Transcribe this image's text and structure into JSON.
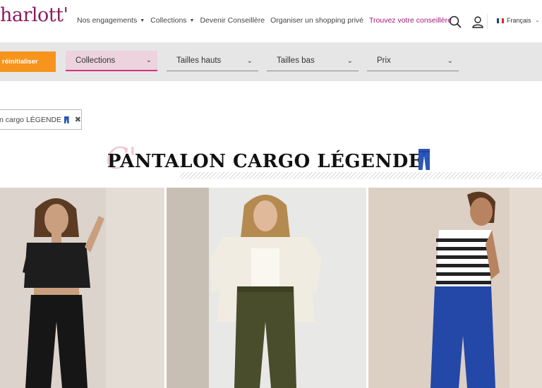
{
  "header": {
    "logo": "harlott'",
    "nav": [
      {
        "label": "Nos engagements",
        "caret": true
      },
      {
        "label": "Collections",
        "caret": true
      },
      {
        "label": "Devenir Conseillère",
        "caret": false
      },
      {
        "label": "Organiser un shopping privé",
        "caret": false
      },
      {
        "label": "Trouvez votre conseillère",
        "caret": false,
        "highlight": true
      }
    ],
    "language": "Français",
    "icons": {
      "search": "search-icon",
      "account": "user-icon",
      "flag": "flag-fr-icon"
    }
  },
  "filters": {
    "reset_label": "réinitialiser",
    "selects": [
      {
        "label": "Collections",
        "active": true
      },
      {
        "label": "Tailles hauts",
        "active": false
      },
      {
        "label": "Tailles bas",
        "active": false
      },
      {
        "label": "Prix",
        "active": false
      }
    ]
  },
  "active_tag": {
    "label": "n cargo LÉGENDE",
    "icon": "jeans-icon",
    "remove_icon": "close-icon"
  },
  "section": {
    "title": "PANTALON CARGO LÉGENDE",
    "decor_letter": "C'",
    "title_icon": "jeans-icon"
  },
  "products": [
    {
      "name": "black-cargo",
      "color": "#1c1c1c"
    },
    {
      "name": "khaki-cargo",
      "color": "#4a4d2c"
    },
    {
      "name": "blue-cargo",
      "color": "#2448a8"
    }
  ],
  "colors": {
    "brand": "#8c1d5c",
    "accent": "#f7941d",
    "highlight": "#a3197a",
    "active_filter": "#ecd3de"
  }
}
